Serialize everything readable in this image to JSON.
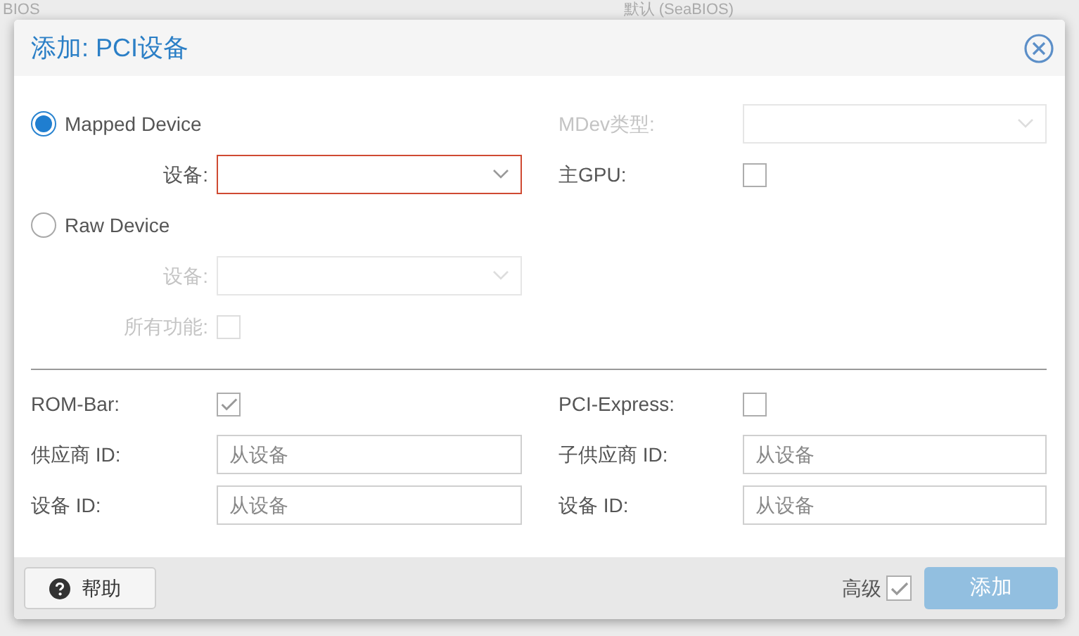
{
  "background": {
    "texts": [
      "BIOS",
      "默认 (SeaBIOS)"
    ]
  },
  "dialog": {
    "title": "添加: PCI设备"
  },
  "modes": [
    {
      "label": "Mapped Device",
      "selected": true,
      "device": {
        "label": "设备:",
        "disabled": false,
        "invalid": true
      }
    },
    {
      "label": "Raw Device",
      "selected": false,
      "device": {
        "label": "设备:",
        "disabled": true,
        "invalid": false
      },
      "all_functions": {
        "label": "所有功能:",
        "checked": false,
        "disabled": true
      }
    }
  ],
  "mdev_type": {
    "label": "MDev类型:",
    "disabled": true
  },
  "primary_gpu": {
    "label": "主GPU:",
    "checked": false
  },
  "advanced_rows": [
    {
      "left": {
        "kind": "checkbox",
        "label": "ROM-Bar:",
        "checked": true
      },
      "right": {
        "kind": "checkbox",
        "label": "PCI-Express:",
        "checked": false
      }
    },
    {
      "left": {
        "kind": "text",
        "label": "供应商 ID:",
        "placeholder": "从设备"
      },
      "right": {
        "kind": "text",
        "label": "子供应商 ID:",
        "placeholder": "从设备"
      }
    },
    {
      "left": {
        "kind": "text",
        "label": "设备 ID:",
        "placeholder": "从设备"
      },
      "right": {
        "kind": "text",
        "label": "设备 ID:",
        "placeholder": "从设备"
      }
    }
  ],
  "footer": {
    "help": "帮助",
    "advanced": {
      "label": "高级",
      "checked": true
    },
    "add": {
      "label": "添加",
      "disabled": true
    }
  }
}
